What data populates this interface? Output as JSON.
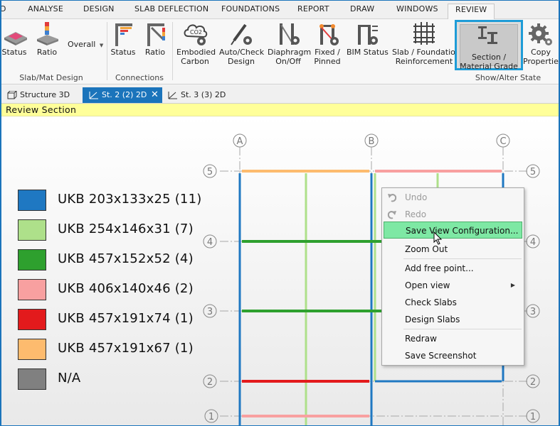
{
  "ribbon_tabs": [
    {
      "label": "D"
    },
    {
      "label": "ANALYSE"
    },
    {
      "label": "DESIGN"
    },
    {
      "label": "SLAB DEFLECTION"
    },
    {
      "label": "FOUNDATIONS"
    },
    {
      "label": "REPORT"
    },
    {
      "label": "DRAW"
    },
    {
      "label": "WINDOWS"
    },
    {
      "label": "REVIEW"
    }
  ],
  "ribbon": {
    "slabmat": {
      "status_label": "Status",
      "ratio_label": "Ratio",
      "overall_label": "Overall",
      "group_label": "Slab/Mat Design"
    },
    "connections": {
      "status_label": "Status",
      "ratio_label": "Ratio",
      "group_label": "Connections"
    },
    "review": {
      "embodied_line1": "Embodied",
      "embodied_line2": "Carbon",
      "autocheck_line1": "Auto/Check",
      "autocheck_line2": "Design",
      "diaphragm_line1": "Diaphragm",
      "diaphragm_line2": "On/Off",
      "fixed_line1": "Fixed /",
      "fixed_line2": "Pinned",
      "bim_line1": "BIM Status",
      "slab_line1": "Slab / Foundation",
      "slab_line2": "Reinforcement",
      "section_line1": "Section /",
      "section_line2": "Material Grade",
      "copy_line1": "Copy",
      "copy_line2": "Properties",
      "group_label": "Show/Alter State"
    }
  },
  "doc_tabs": [
    {
      "label": "Structure 3D"
    },
    {
      "label": "St. 2 (2) 2D"
    },
    {
      "label": "St. 3 (3) 2D"
    }
  ],
  "close_glyph": "✕",
  "banner": {
    "title": "Review Section"
  },
  "grid": {
    "cols": [
      "A",
      "B",
      "C"
    ],
    "rows": [
      "5",
      "4",
      "3",
      "2",
      "1"
    ]
  },
  "legend": [
    {
      "label": "UKB 203x133x25 (11)",
      "color": "#1f78c2"
    },
    {
      "label": "UKB 254x146x31 (7)",
      "color": "#aee08a"
    },
    {
      "label": "UKB 457x152x52 (4)",
      "color": "#2ea02e"
    },
    {
      "label": "UKB 406x140x46 (2)",
      "color": "#f8a0a0"
    },
    {
      "label": "UKB 457x191x74 (1)",
      "color": "#e31a1c"
    },
    {
      "label": "UKB 457x191x67 (1)",
      "color": "#fdbb6e"
    },
    {
      "label": "N/A",
      "color": "#808080"
    }
  ],
  "context_menu": {
    "undo": "Undo",
    "redo": "Redo",
    "save_view": "Save View Configuration...",
    "zoom_out": "Zoom Out",
    "add_point": "Add free point...",
    "open_view": "Open view",
    "check_slabs": "Check Slabs",
    "design_slabs": "Design Slabs",
    "redraw": "Redraw",
    "save_screenshot": "Save Screenshot"
  },
  "co2_text": "CO2"
}
